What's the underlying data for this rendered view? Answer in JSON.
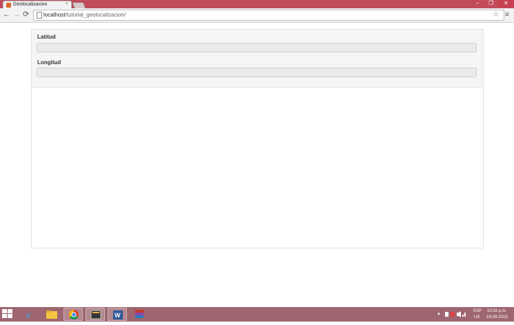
{
  "browser": {
    "tab_title": "Geolocalizacion",
    "tab_close": "×",
    "url_host": "localhost",
    "url_path": "/tutorial_geolocalizacion/",
    "back_glyph": "←",
    "forward_glyph": "→",
    "reload_glyph": "⟳",
    "star_glyph": "☆",
    "menu_glyph": "≡",
    "min_glyph": "–",
    "max_glyph": "❐",
    "close_glyph": "✕"
  },
  "form": {
    "latitude_label": "Latitud",
    "latitude_value": "",
    "longitude_label": "Longitud",
    "longitude_value": ""
  },
  "taskbar": {
    "language": "ESP",
    "region": "US",
    "time": "10:33 p.m.",
    "date": "19-09-2015",
    "tray_arrow": "▲"
  },
  "colors": {
    "titlebar": "#c24b5c",
    "taskbar": "#9e6670",
    "chrome_accent": "#e06a2b"
  }
}
